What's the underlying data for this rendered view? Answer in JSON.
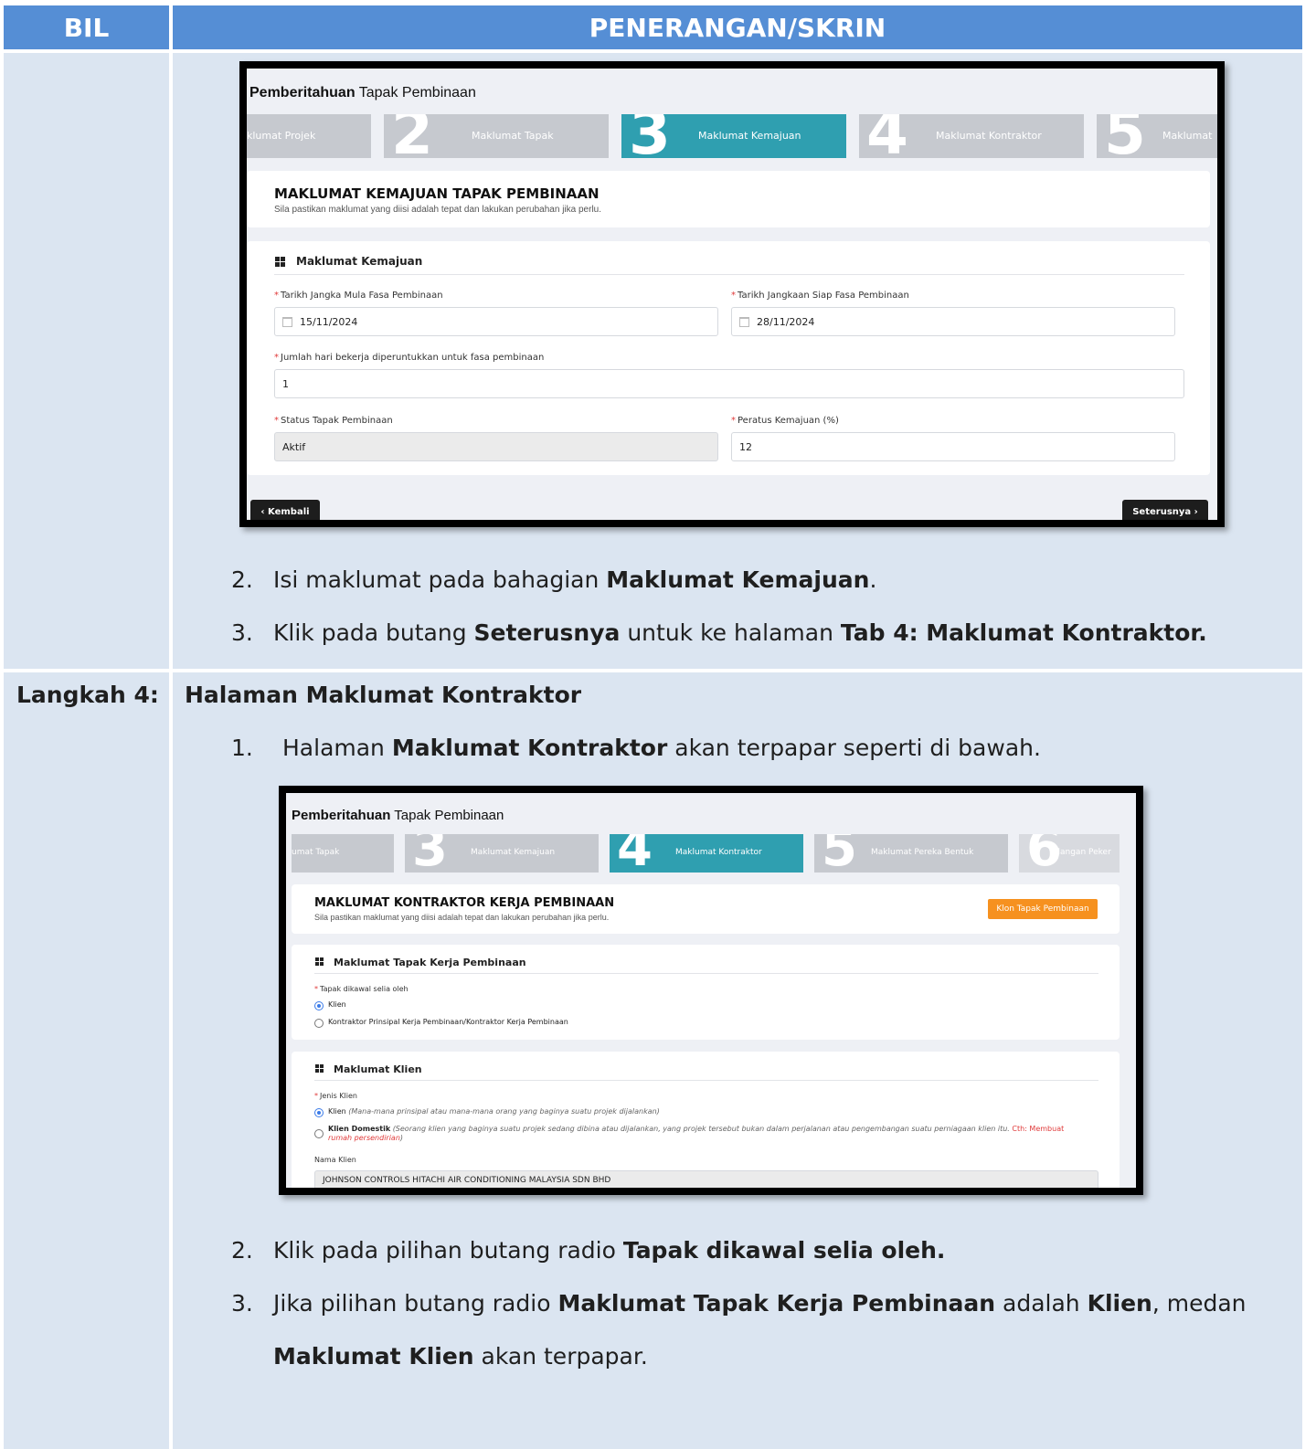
{
  "table": {
    "header_bil": "BIL",
    "header_penerangan": "PENERANGAN/SKRIN"
  },
  "row1": {
    "screenshot": {
      "title_bold": "Pemberitahuan",
      "title_rest": "Tapak Pembinaan",
      "steps": [
        {
          "num": "",
          "label": "klumat Projek",
          "active": false
        },
        {
          "num": "2",
          "label": "Maklumat Tapak",
          "active": false
        },
        {
          "num": "3",
          "label": "Maklumat Kemajuan",
          "active": true
        },
        {
          "num": "4",
          "label": "Maklumat Kontraktor",
          "active": false
        },
        {
          "num": "5",
          "label": "Maklumat",
          "active": false
        }
      ],
      "card_title": "MAKLUMAT KEMAJUAN TAPAK PEMBINAAN",
      "card_subtitle": "Sila pastikan maklumat yang diisi adalah tepat dan lakukan perubahan jika perlu.",
      "section_title": "Maklumat Kemajuan",
      "fields": {
        "start_date_label": "Tarikh Jangka Mula Fasa Pembinaan",
        "start_date_value": "15/11/2024",
        "end_date_label": "Tarikh Jangkaan Siap Fasa Pembinaan",
        "end_date_value": "28/11/2024",
        "working_days_label": "Jumlah hari bekerja diperuntukkan untuk fasa pembinaan",
        "working_days_value": "1",
        "status_label": "Status Tapak Pembinaan",
        "status_value": "Aktif",
        "progress_label": "Peratus Kemajuan (%)",
        "progress_value": "12"
      },
      "back_button": "‹ Kembali",
      "next_button": "Seterusnya ›"
    },
    "instructions": [
      {
        "num": "2.",
        "pre": "Isi maklumat pada bahagian ",
        "bold": "Maklumat Kemajuan",
        "post": ".",
        "bold2": "",
        "post2": ""
      },
      {
        "num": "3.",
        "pre": "Klik pada butang ",
        "bold": "Seterusnya",
        "post": " untuk ke halaman ",
        "bold2": "Tab 4: Maklumat Kontraktor.",
        "post2": ""
      }
    ]
  },
  "row2": {
    "step_label": "Langkah 4:",
    "title": "Halaman Maklumat Kontraktor",
    "intro": {
      "num": "1.",
      "pre": "Halaman ",
      "bold": "Maklumat Kontraktor",
      "post": " akan terpapar seperti di bawah."
    },
    "screenshot": {
      "title_bold": "Pemberitahuan",
      "title_rest": "Tapak Pembinaan",
      "steps": [
        {
          "num": "",
          "label": "umat Tapak",
          "active": false
        },
        {
          "num": "3",
          "label": "Maklumat Kemajuan",
          "active": false
        },
        {
          "num": "4",
          "label": "Maklumat Kontraktor",
          "active": true
        },
        {
          "num": "5",
          "label": "Maklumat Pereka Bentuk",
          "active": false
        },
        {
          "num": "6",
          "label": "ilangan Peker",
          "active": false
        }
      ],
      "card_title": "MAKLUMAT KONTRAKTOR KERJA PEMBINAAN",
      "card_subtitle": "Sila pastikan maklumat yang diisi adalah tepat dan lakukan perubahan jika perlu.",
      "clone_button": "Klon Tapak Pembinaan",
      "section1_title": "Maklumat Tapak Kerja Pembinaan",
      "supervised_label": "Tapak dikawal selia oleh",
      "supervised_opt1": "Klien",
      "supervised_opt2": "Kontraktor Prinsipal Kerja Pembinaan/Kontraktor Kerja Pembinaan",
      "section2_title": "Maklumat Klien",
      "client_type_label": "Jenis Klien",
      "client_opt1": "Klien",
      "client_opt1_note": "(Mana-mana prinsipal atau mana-mana orang yang baginya suatu projek dijalankan)",
      "client_opt2": "Klien Domestik",
      "client_opt2_note": "(Seorang klien yang baginya suatu projek sedang dibina atau dijalankan, yang projek tersebut bukan dalam perjalanan atau pengembangan suatu perniagaan klien itu.",
      "client_opt2_red": "Cth: Membuat",
      "client_opt2_red2": "rumah persendirian",
      "client_opt2_tail": ")",
      "client_name_label": "Nama Klien",
      "client_name_value": "JOHNSON CONTROLS HITACHI AIR CONDITIONING MALAYSIA SDN BHD"
    },
    "instructions": [
      {
        "num": "2.",
        "pre": "Klik pada pilihan butang radio ",
        "bold": "Tapak dikawal selia oleh.",
        "post": ""
      },
      {
        "num": "3.",
        "pre": "Jika pilihan butang radio ",
        "bold": "Maklumat Tapak Kerja Pembinaan",
        "post": " adalah ",
        "bold2": "Klien",
        "post2": ", medan"
      },
      {
        "bold": "Maklumat Klien",
        "post": " akan terpapar."
      }
    ]
  }
}
